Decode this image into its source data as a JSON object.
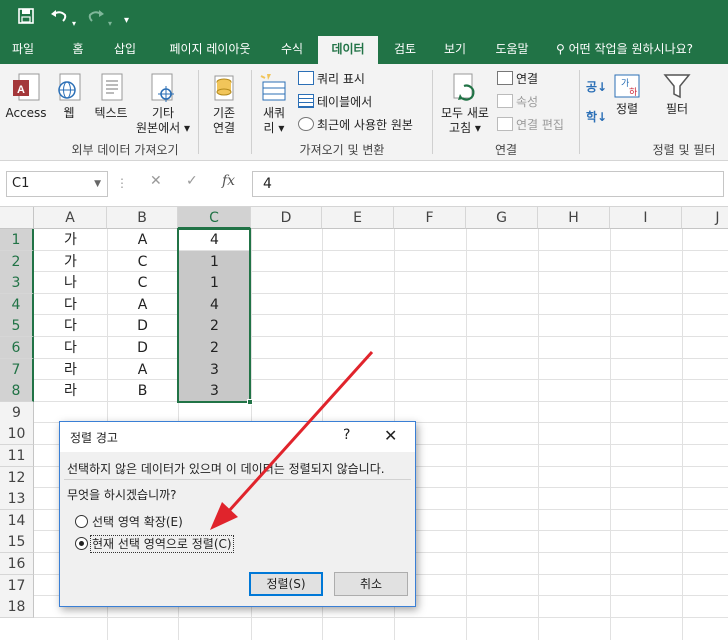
{
  "qat": {
    "save_icon": "save-icon",
    "undo_icon": "undo-icon",
    "redo_icon": "redo-icon",
    "customize_icon": "customize-qat-icon"
  },
  "tabs": [
    {
      "label": "파일",
      "active": false
    },
    {
      "label": "홈",
      "active": false
    },
    {
      "label": "삽입",
      "active": false
    },
    {
      "label": "페이지 레이아웃",
      "active": false
    },
    {
      "label": "수식",
      "active": false
    },
    {
      "label": "데이터",
      "active": true
    },
    {
      "label": "검토",
      "active": false
    },
    {
      "label": "보기",
      "active": false
    },
    {
      "label": "도움말",
      "active": false
    }
  ],
  "tell_me": "어떤 작업을 원하시나요?",
  "ribbon": {
    "access": "Access",
    "web": "웹",
    "text": "텍스트",
    "other_1": "기타",
    "other_2": "원본에서 ▾",
    "existing_1": "기존",
    "existing_2": "연결",
    "group_external": "외부 데이터 가져오기",
    "new_query_1": "새쿼",
    "new_query_2": "리 ▾",
    "show_query": "쿼리 표시",
    "from_table": "테이블에서",
    "recent_sources": "최근에 사용한 원본",
    "group_get": "가져오기 및 변환",
    "refresh_1": "모두 새로",
    "refresh_2": "고침 ▾",
    "connections": "연결",
    "properties": "속성",
    "edit_links": "연결 편집",
    "group_connections": "연결",
    "sort_az": "공↓",
    "sort_za": "학↓",
    "sort": "정렬",
    "filter": "필터",
    "group_sort": "정렬 및 필터"
  },
  "formula_bar": {
    "name_box": "C1",
    "value": "4",
    "fx": "fx"
  },
  "sheet": {
    "columns": [
      "A",
      "B",
      "C",
      "D",
      "E",
      "F",
      "G",
      "H",
      "I",
      "J"
    ],
    "rows": [
      "1",
      "2",
      "3",
      "4",
      "5",
      "6",
      "7",
      "8",
      "9",
      "10",
      "11",
      "12",
      "13",
      "14",
      "15",
      "16",
      "17",
      "18"
    ],
    "col_a": [
      "가",
      "가",
      "나",
      "다",
      "다",
      "다",
      "라",
      "라"
    ],
    "col_b": [
      "A",
      "C",
      "C",
      "A",
      "D",
      "D",
      "A",
      "B"
    ],
    "col_c": [
      "4",
      "1",
      "1",
      "4",
      "2",
      "2",
      "3",
      "3"
    ]
  },
  "dialog": {
    "title": "정렬 경고",
    "help": "?",
    "close": "✕",
    "message": "선택하지 않은 데이터가 있으며 이 데이터는 정렬되지 않습니다.",
    "question": "무엇을 하시겠습니까?",
    "option_expand": "선택 영역 확장(E)",
    "option_current": "현재 선택 영역으로 정렬(C)",
    "sort_button": "정렬(S)",
    "cancel_button": "취소"
  },
  "colors": {
    "excel_green": "#217346",
    "selection_gray": "#c8c8c8",
    "annotation_red": "#e0242c"
  }
}
